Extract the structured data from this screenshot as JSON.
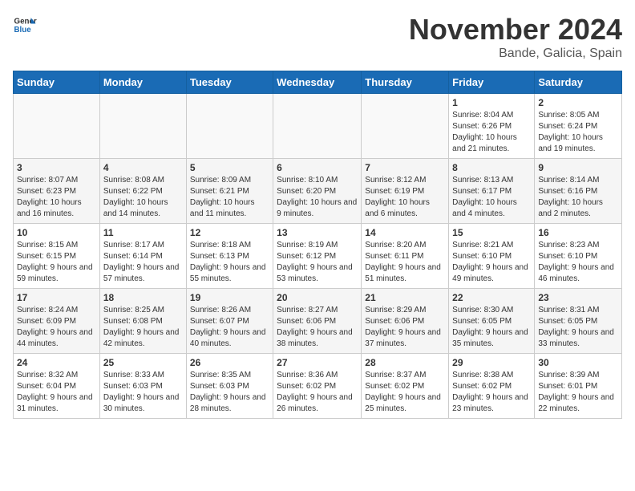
{
  "logo": {
    "text_general": "General",
    "text_blue": "Blue"
  },
  "header": {
    "month": "November 2024",
    "location": "Bande, Galicia, Spain"
  },
  "weekdays": [
    "Sunday",
    "Monday",
    "Tuesday",
    "Wednesday",
    "Thursday",
    "Friday",
    "Saturday"
  ],
  "weeks": [
    [
      {
        "day": "",
        "info": ""
      },
      {
        "day": "",
        "info": ""
      },
      {
        "day": "",
        "info": ""
      },
      {
        "day": "",
        "info": ""
      },
      {
        "day": "",
        "info": ""
      },
      {
        "day": "1",
        "info": "Sunrise: 8:04 AM\nSunset: 6:26 PM\nDaylight: 10 hours and 21 minutes."
      },
      {
        "day": "2",
        "info": "Sunrise: 8:05 AM\nSunset: 6:24 PM\nDaylight: 10 hours and 19 minutes."
      }
    ],
    [
      {
        "day": "3",
        "info": "Sunrise: 8:07 AM\nSunset: 6:23 PM\nDaylight: 10 hours and 16 minutes."
      },
      {
        "day": "4",
        "info": "Sunrise: 8:08 AM\nSunset: 6:22 PM\nDaylight: 10 hours and 14 minutes."
      },
      {
        "day": "5",
        "info": "Sunrise: 8:09 AM\nSunset: 6:21 PM\nDaylight: 10 hours and 11 minutes."
      },
      {
        "day": "6",
        "info": "Sunrise: 8:10 AM\nSunset: 6:20 PM\nDaylight: 10 hours and 9 minutes."
      },
      {
        "day": "7",
        "info": "Sunrise: 8:12 AM\nSunset: 6:19 PM\nDaylight: 10 hours and 6 minutes."
      },
      {
        "day": "8",
        "info": "Sunrise: 8:13 AM\nSunset: 6:17 PM\nDaylight: 10 hours and 4 minutes."
      },
      {
        "day": "9",
        "info": "Sunrise: 8:14 AM\nSunset: 6:16 PM\nDaylight: 10 hours and 2 minutes."
      }
    ],
    [
      {
        "day": "10",
        "info": "Sunrise: 8:15 AM\nSunset: 6:15 PM\nDaylight: 9 hours and 59 minutes."
      },
      {
        "day": "11",
        "info": "Sunrise: 8:17 AM\nSunset: 6:14 PM\nDaylight: 9 hours and 57 minutes."
      },
      {
        "day": "12",
        "info": "Sunrise: 8:18 AM\nSunset: 6:13 PM\nDaylight: 9 hours and 55 minutes."
      },
      {
        "day": "13",
        "info": "Sunrise: 8:19 AM\nSunset: 6:12 PM\nDaylight: 9 hours and 53 minutes."
      },
      {
        "day": "14",
        "info": "Sunrise: 8:20 AM\nSunset: 6:11 PM\nDaylight: 9 hours and 51 minutes."
      },
      {
        "day": "15",
        "info": "Sunrise: 8:21 AM\nSunset: 6:10 PM\nDaylight: 9 hours and 49 minutes."
      },
      {
        "day": "16",
        "info": "Sunrise: 8:23 AM\nSunset: 6:10 PM\nDaylight: 9 hours and 46 minutes."
      }
    ],
    [
      {
        "day": "17",
        "info": "Sunrise: 8:24 AM\nSunset: 6:09 PM\nDaylight: 9 hours and 44 minutes."
      },
      {
        "day": "18",
        "info": "Sunrise: 8:25 AM\nSunset: 6:08 PM\nDaylight: 9 hours and 42 minutes."
      },
      {
        "day": "19",
        "info": "Sunrise: 8:26 AM\nSunset: 6:07 PM\nDaylight: 9 hours and 40 minutes."
      },
      {
        "day": "20",
        "info": "Sunrise: 8:27 AM\nSunset: 6:06 PM\nDaylight: 9 hours and 38 minutes."
      },
      {
        "day": "21",
        "info": "Sunrise: 8:29 AM\nSunset: 6:06 PM\nDaylight: 9 hours and 37 minutes."
      },
      {
        "day": "22",
        "info": "Sunrise: 8:30 AM\nSunset: 6:05 PM\nDaylight: 9 hours and 35 minutes."
      },
      {
        "day": "23",
        "info": "Sunrise: 8:31 AM\nSunset: 6:05 PM\nDaylight: 9 hours and 33 minutes."
      }
    ],
    [
      {
        "day": "24",
        "info": "Sunrise: 8:32 AM\nSunset: 6:04 PM\nDaylight: 9 hours and 31 minutes."
      },
      {
        "day": "25",
        "info": "Sunrise: 8:33 AM\nSunset: 6:03 PM\nDaylight: 9 hours and 30 minutes."
      },
      {
        "day": "26",
        "info": "Sunrise: 8:35 AM\nSunset: 6:03 PM\nDaylight: 9 hours and 28 minutes."
      },
      {
        "day": "27",
        "info": "Sunrise: 8:36 AM\nSunset: 6:02 PM\nDaylight: 9 hours and 26 minutes."
      },
      {
        "day": "28",
        "info": "Sunrise: 8:37 AM\nSunset: 6:02 PM\nDaylight: 9 hours and 25 minutes."
      },
      {
        "day": "29",
        "info": "Sunrise: 8:38 AM\nSunset: 6:02 PM\nDaylight: 9 hours and 23 minutes."
      },
      {
        "day": "30",
        "info": "Sunrise: 8:39 AM\nSunset: 6:01 PM\nDaylight: 9 hours and 22 minutes."
      }
    ]
  ]
}
